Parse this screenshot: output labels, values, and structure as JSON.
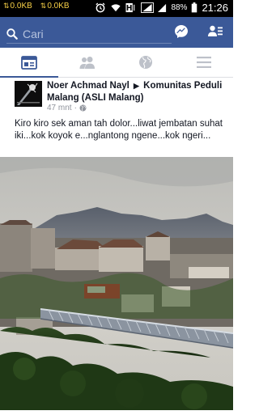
{
  "status_bar": {
    "net_left": "0.0KB",
    "net_right": "0.0KB",
    "battery": "88%",
    "time": "21:26"
  },
  "search": {
    "placeholder": "Cari",
    "icons": [
      "search-icon",
      "messenger-icon",
      "friend-requests-icon"
    ]
  },
  "tabs": [
    {
      "name": "news-feed",
      "active": true
    },
    {
      "name": "friends",
      "active": false
    },
    {
      "name": "globe",
      "active": false
    },
    {
      "name": "menu",
      "active": false
    }
  ],
  "post": {
    "author": "Noer Achmad Nayl",
    "group": "Komunitas Peduli Malang (ASLI Malang)",
    "time": "47 mnt",
    "text": "Kiro kiro sek aman tah dolor...liwat jembatan suhat iki...kok koyok e...nglantong ngene...kok ngeri..."
  },
  "colors": {
    "brand": "#3b5998",
    "status_accent": "#f7d046"
  }
}
